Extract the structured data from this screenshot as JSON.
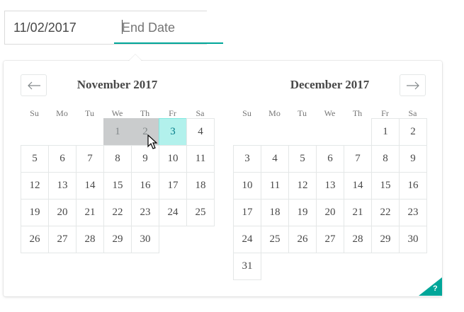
{
  "range": {
    "start_value": "11/02/2017",
    "end_placeholder": "End Date"
  },
  "nav": {
    "prev_icon": "arrow-left-icon",
    "next_icon": "arrow-right-icon"
  },
  "weekdays": [
    "Su",
    "Mo",
    "Tu",
    "We",
    "Th",
    "Fr",
    "Sa"
  ],
  "months": [
    {
      "title": "November 2017",
      "weeks": [
        [
          "",
          "",
          "",
          "1",
          "2",
          "3",
          "4"
        ],
        [
          "5",
          "6",
          "7",
          "8",
          "9",
          "10",
          "11"
        ],
        [
          "12",
          "13",
          "14",
          "15",
          "16",
          "17",
          "18"
        ],
        [
          "19",
          "20",
          "21",
          "22",
          "23",
          "24",
          "25"
        ],
        [
          "26",
          "27",
          "28",
          "29",
          "30",
          "",
          ""
        ]
      ],
      "selected_days": [
        "1",
        "2"
      ],
      "hovered_day": "3"
    },
    {
      "title": "December 2017",
      "weeks": [
        [
          "",
          "",
          "",
          "",
          "",
          "1",
          "2"
        ],
        [
          "3",
          "4",
          "5",
          "6",
          "7",
          "8",
          "9"
        ],
        [
          "10",
          "11",
          "12",
          "13",
          "14",
          "15",
          "16"
        ],
        [
          "17",
          "18",
          "19",
          "20",
          "21",
          "22",
          "23"
        ],
        [
          "24",
          "25",
          "26",
          "27",
          "28",
          "29",
          "30"
        ],
        [
          "31",
          "",
          "",
          "",
          "",
          "",
          ""
        ]
      ],
      "selected_days": [],
      "hovered_day": ""
    }
  ],
  "help": {
    "label": "?"
  },
  "colors": {
    "accent": "#00a699",
    "hover": "#b2f1ec",
    "selected": "#cacccd"
  }
}
